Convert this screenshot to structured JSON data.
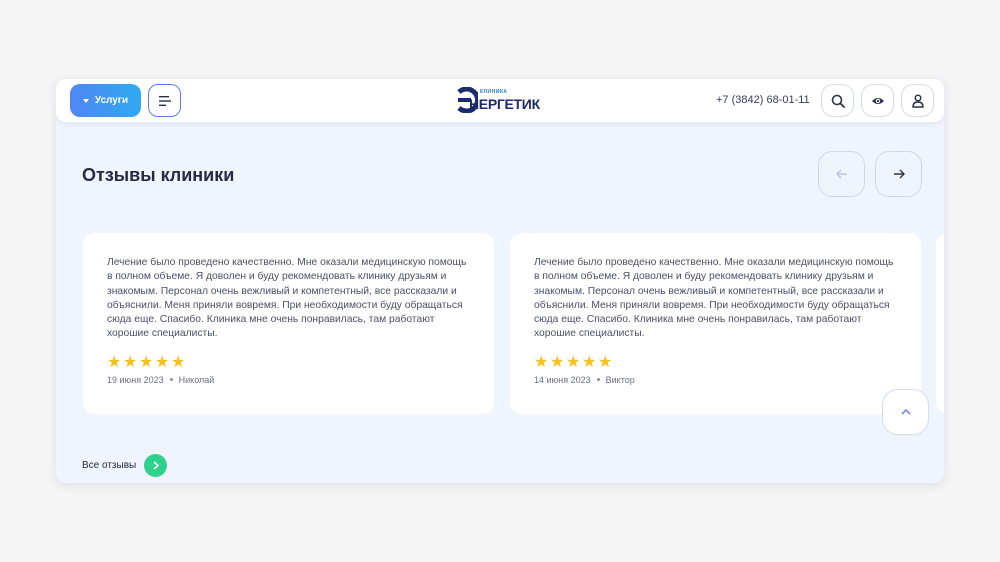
{
  "header": {
    "services_label": "Услуги",
    "logo": {
      "small": "КЛИНИКА",
      "big": "НЕРГЕТИК"
    },
    "phone": "+7 (3842) 68-01-11"
  },
  "section": {
    "title": "Отзывы клиники",
    "all_reviews_label": "Все отзывы"
  },
  "reviews": [
    {
      "text": "Лечение было проведено качественно. Мне оказали медицинскую помощь в полном объеме. Я доволен и буду рекомендовать клинику друзьям и знакомым. Персонал очень вежливый и компетентный, все рассказали и объяснили. Меня приняли вовремя. При необходимости буду обращаться сюда еще. Спасибо. Клиника мне очень понравилась, там работают хорошие специалисты.",
      "rating": 5,
      "date": "19 июня 2023",
      "author": "Николай"
    },
    {
      "text": "Лечение было проведено качественно. Мне оказали медицинскую помощь в полном объеме. Я доволен и буду рекомендовать клинику друзьям и знакомым. Персонал очень вежливый и компетентный, все рассказали и объяснили. Меня приняли вовремя. При необходимости буду обращаться сюда еще. Спасибо. Клиника мне очень понравилась, там работают хорошие специалисты.",
      "rating": 5,
      "date": "14 июня 2023",
      "author": "Виктор"
    }
  ],
  "colors": {
    "accent": "#4f86f5",
    "star": "#f5c01e",
    "go": "#2fd18c",
    "background": "#eff4fd"
  },
  "icons": [
    "caret-down-icon",
    "menu-icon",
    "search-icon",
    "eye-icon",
    "user-icon",
    "arrow-left-icon",
    "arrow-right-icon",
    "chevron-up-icon",
    "chevron-right-icon",
    "star-icon"
  ]
}
